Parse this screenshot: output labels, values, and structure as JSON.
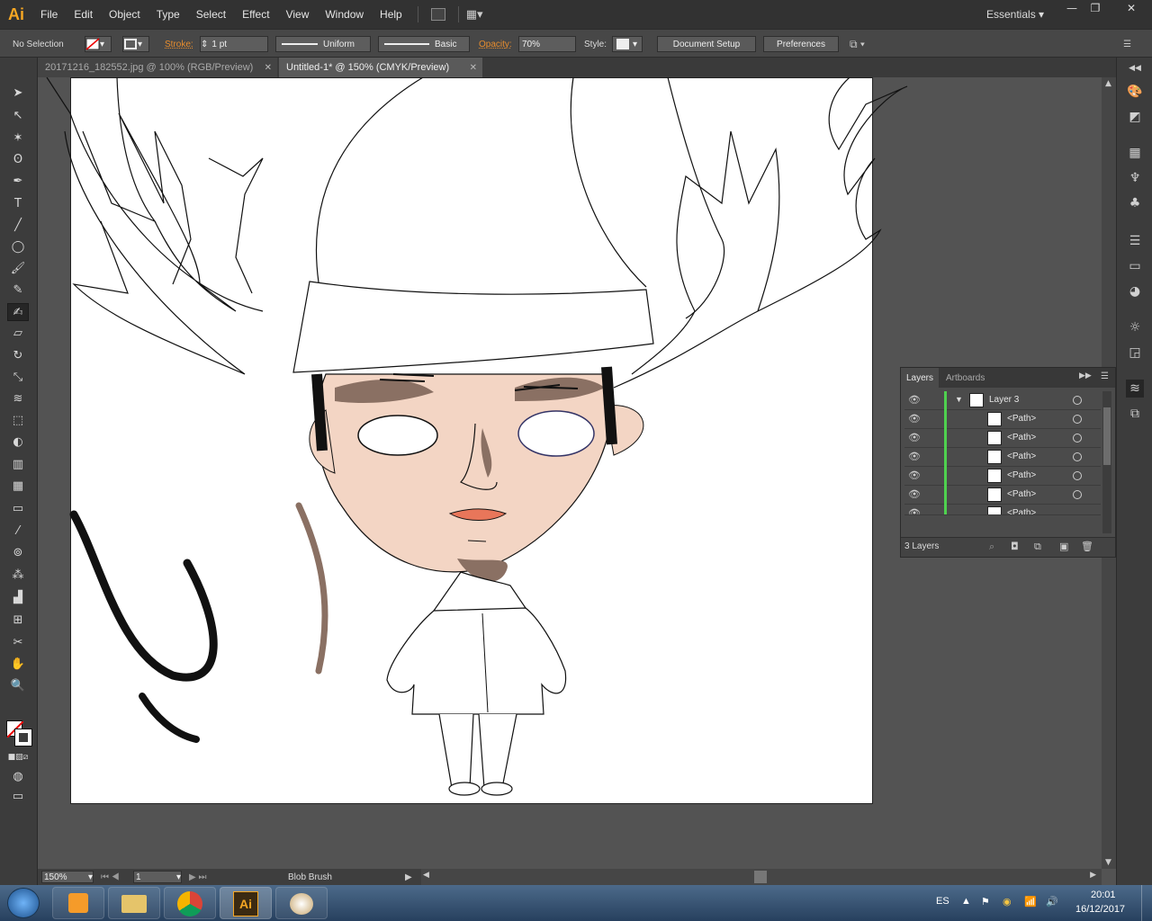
{
  "app": {
    "logo": "Ai"
  },
  "menu": [
    "File",
    "Edit",
    "Object",
    "Type",
    "Select",
    "Effect",
    "View",
    "Window",
    "Help"
  ],
  "workspace": "Essentials",
  "control_bar": {
    "selection": "No Selection",
    "stroke_label": "Stroke:",
    "stroke_weight": "1 pt",
    "profile": "Uniform",
    "brush": "Basic",
    "opacity_label": "Opacity:",
    "opacity_value": "70%",
    "style_label": "Style:",
    "document_setup": "Document Setup",
    "preferences": "Preferences"
  },
  "tabs": [
    {
      "label": "20171216_182552.jpg @ 100% (RGB/Preview)",
      "active": false
    },
    {
      "label": "Untitled-1* @ 150% (CMYK/Preview)",
      "active": true
    }
  ],
  "status": {
    "zoom": "150%",
    "artboard": "1",
    "tool": "Blob Brush"
  },
  "layers_panel": {
    "tab_layers": "Layers",
    "tab_artboards": "Artboards",
    "rows": [
      {
        "name": "Layer 3",
        "type": "layer"
      },
      {
        "name": "<Path>",
        "type": "path"
      },
      {
        "name": "<Path>",
        "type": "path"
      },
      {
        "name": "<Path>",
        "type": "path"
      },
      {
        "name": "<Path>",
        "type": "path"
      },
      {
        "name": "<Path>",
        "type": "path"
      },
      {
        "name": "<Path>",
        "type": "path"
      }
    ],
    "footer": "3 Layers"
  },
  "taskbar": {
    "lang": "ES",
    "time": "20:01",
    "date": "16/12/2017"
  },
  "colors": {
    "skin": "#f3d5c4",
    "shade": "#8a7063",
    "lips": "#e8765a",
    "ai_orange": "#f5a623"
  }
}
